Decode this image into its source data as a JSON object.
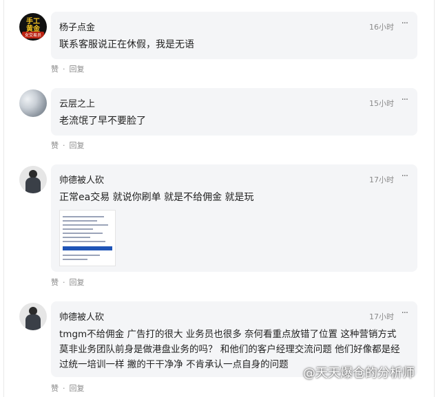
{
  "comments": [
    {
      "author": "杨子点金",
      "time": "16小时",
      "text": "联系客服说正在休假，我是无语",
      "avatar_text_1": "手工",
      "avatar_text_2": "黄金",
      "avatar_text_3": "女交易员"
    },
    {
      "author": "云层之上",
      "time": "15小时",
      "text": "老流氓了早不要脸了"
    },
    {
      "author": "帅德被人砍",
      "time": "17小时",
      "text": "正常ea交易 就说你刷单 就是不给佣金 就是玩"
    },
    {
      "author": "帅德被人砍",
      "time": "17小时",
      "text": "tmgm不给佣金 广告打的很大 业务员也很多 奈何看重点放错了位置 这种营销方式 莫非业务团队前身是做港盘业务的吗？ 和他们的客户经理交流问题 他们好像都是经过统一培训一样 撇的干干净净 不肯承认一点自身的问题"
    }
  ],
  "actions": {
    "like": "赞",
    "sep": "·",
    "reply": "回复"
  },
  "more_icon": "···",
  "watermark": "@天天爆仓的分析师"
}
